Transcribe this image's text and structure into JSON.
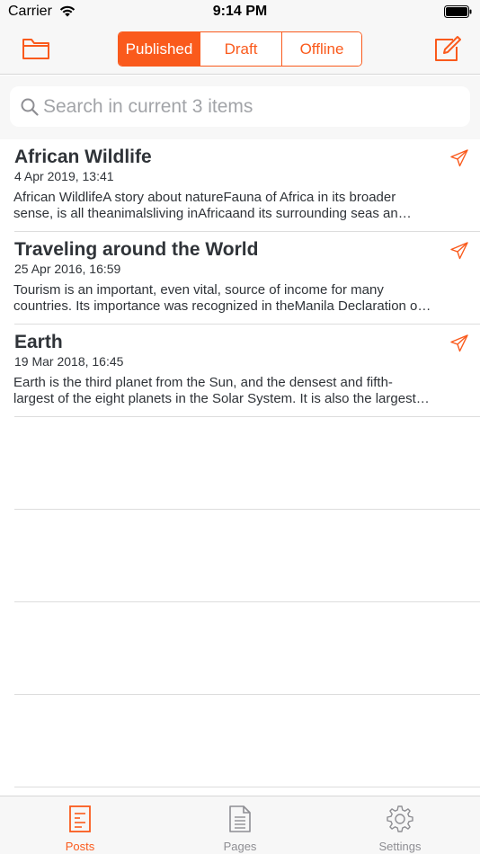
{
  "status_bar": {
    "carrier": "Carrier",
    "time": "9:14 PM"
  },
  "nav": {
    "segments": [
      "Published",
      "Draft",
      "Offline"
    ],
    "active_segment": "Published",
    "accent_color": "#fa5a1c",
    "left_icon": "folder-icon",
    "right_icon": "compose-icon"
  },
  "search": {
    "placeholder": "Search in current 3 items"
  },
  "posts": [
    {
      "title": "African Wildlife",
      "date": "4 Apr 2019, 13:41",
      "excerpt_line1": "African WildlifeA story about natureFauna of Africa in its broader",
      "excerpt_line2": "sense, is all theanimalsliving inAfricaand its surrounding seas an…"
    },
    {
      "title": "Traveling around the World",
      "date": "25 Apr 2016, 16:59",
      "excerpt_line1": "Tourism is an important, even vital, source of income for many",
      "excerpt_line2": "countries. Its importance was recognized in theManila Declaration o…"
    },
    {
      "title": "Earth",
      "date": "19 Mar 2018, 16:45",
      "excerpt_line1": "Earth is the third planet from the Sun, and the densest and fifth-",
      "excerpt_line2": "largest of the eight planets in the Solar System. It is also the largest…"
    }
  ],
  "tabs": [
    {
      "label": "Posts",
      "icon": "posts-icon",
      "active": true
    },
    {
      "label": "Pages",
      "icon": "pages-icon",
      "active": false
    },
    {
      "label": "Settings",
      "icon": "gear-icon",
      "active": false
    }
  ]
}
